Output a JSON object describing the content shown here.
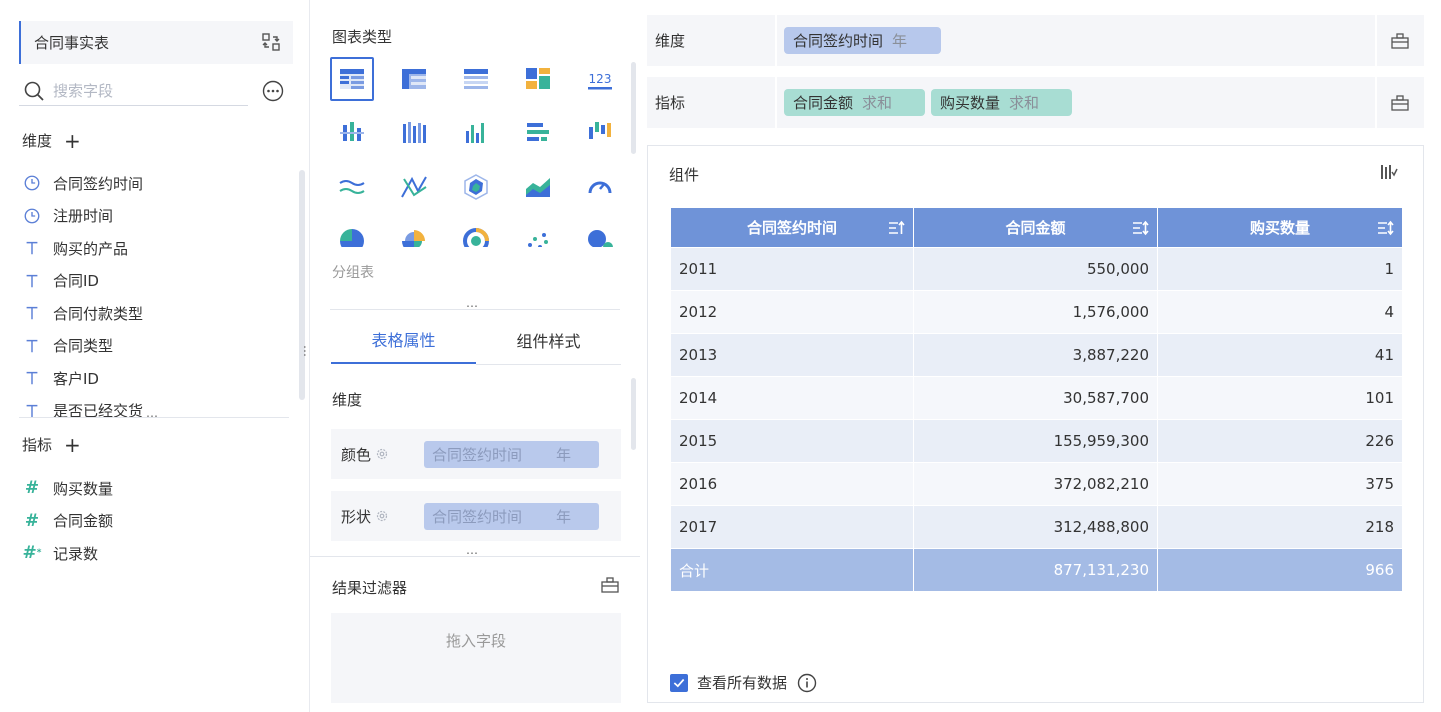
{
  "left": {
    "table_name": "合同事实表",
    "search_placeholder": "搜索字段",
    "dimension_title": "维度",
    "dimension_plus": "+",
    "dimensions": [
      {
        "label": "合同签约时间",
        "icon": "clock-icon"
      },
      {
        "label": "注册时间",
        "icon": "clock-icon"
      },
      {
        "label": "购买的产品",
        "icon": "text-type-icon"
      },
      {
        "label": "合同ID",
        "icon": "text-type-icon"
      },
      {
        "label": "合同付款类型",
        "icon": "text-type-icon"
      },
      {
        "label": "合同类型",
        "icon": "text-type-icon"
      },
      {
        "label": "客户ID",
        "icon": "text-type-icon"
      },
      {
        "label": "是否已经交货",
        "icon": "text-type-icon"
      }
    ],
    "metric_title": "指标",
    "metric_plus": "+",
    "metrics": [
      {
        "label": "购买数量",
        "icon": "hash-icon"
      },
      {
        "label": "合同金额",
        "icon": "hash-icon"
      },
      {
        "label": "记录数",
        "icon": "hash-star-icon"
      }
    ]
  },
  "middle": {
    "chart_type_title": "图表类型",
    "chart_types": [
      "grouped-table",
      "cross-table",
      "detail-table",
      "kpi-card",
      "number",
      "multi-bar",
      "stacked-bar",
      "column",
      "bar-horizontal",
      "range-column",
      "line",
      "polar-line",
      "radar",
      "area",
      "gauge",
      "pie",
      "rose",
      "polar-ring",
      "scatter",
      "bubble"
    ],
    "selected_chart_label": "分组表",
    "tabs": [
      "表格属性",
      "组件样式"
    ],
    "active_tab": 0,
    "dimension_title": "维度",
    "properties": [
      {
        "label": "颜色",
        "field": "合同签约时间",
        "unit": "年"
      },
      {
        "label": "形状",
        "field": "合同签约时间",
        "unit": "年"
      }
    ],
    "filter_title": "结果过滤器",
    "drop_placeholder": "拖入字段"
  },
  "shelves": {
    "dimension_label": "维度",
    "dimension_chips": [
      {
        "field": "合同签约时间",
        "agg": "年"
      }
    ],
    "metric_label": "指标",
    "metric_chips": [
      {
        "field": "合同金额",
        "agg": "求和"
      },
      {
        "field": "购买数量",
        "agg": "求和"
      }
    ]
  },
  "widget": {
    "title": "组件",
    "columns": [
      "合同签约时间",
      "合同金额",
      "购买数量"
    ],
    "rows": [
      [
        "2011",
        "550,000",
        "1"
      ],
      [
        "2012",
        "1,576,000",
        "4"
      ],
      [
        "2013",
        "3,887,220",
        "41"
      ],
      [
        "2014",
        "30,587,700",
        "101"
      ],
      [
        "2015",
        "155,959,300",
        "226"
      ],
      [
        "2016",
        "372,082,210",
        "375"
      ],
      [
        "2017",
        "312,488,800",
        "218"
      ]
    ],
    "total": [
      "合计",
      "877,131,230",
      "966"
    ],
    "view_all_label": "查看所有数据",
    "view_all_checked": true
  },
  "colors": {
    "accent": "#3d6fd8",
    "header_bg": "#6f93d8",
    "total_bg": "#a4bbe5",
    "dim_chip": "#b7c8ec",
    "metric_chip": "#a8ddd3"
  }
}
